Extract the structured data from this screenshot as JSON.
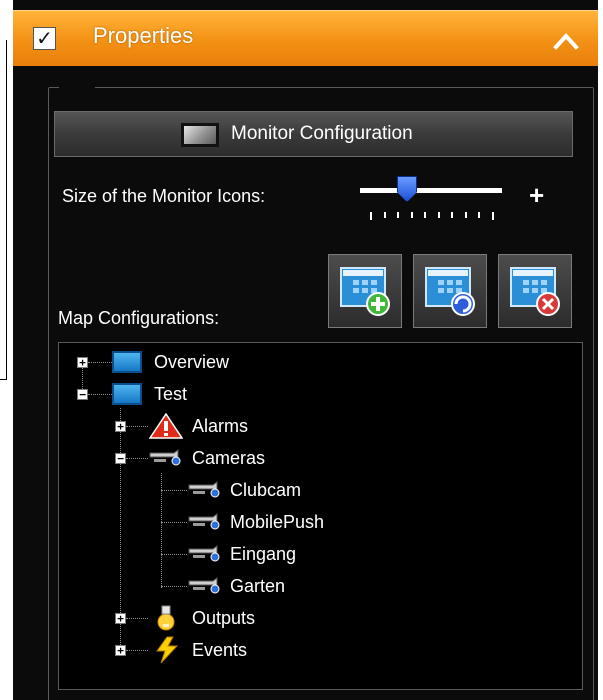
{
  "header": {
    "title": "Properties",
    "checked": true
  },
  "monitor_config": {
    "label": "Monitor Configuration"
  },
  "size_section": {
    "label": "Size of the Monitor Icons:",
    "plus": "+",
    "slider_level": 0.3
  },
  "map_section": {
    "label": "Map Configurations:",
    "buttons": [
      "add-map-icon",
      "refresh-map-icon",
      "delete-map-icon"
    ]
  },
  "tree": {
    "items": [
      {
        "label": "Overview",
        "expander": "+",
        "icon": "map-icon"
      },
      {
        "label": "Test",
        "expander": "−",
        "icon": "map-icon"
      },
      {
        "label": "Alarms",
        "expander": "+",
        "icon": "alarm-warning-icon"
      },
      {
        "label": "Cameras",
        "expander": "−",
        "icon": "camera-icon"
      },
      {
        "label": "Clubcam",
        "icon": "camera-icon"
      },
      {
        "label": "MobilePush",
        "icon": "camera-icon"
      },
      {
        "label": "Eingang",
        "icon": "camera-icon"
      },
      {
        "label": "Garten",
        "icon": "camera-icon"
      },
      {
        "label": "Outputs",
        "expander": "+",
        "icon": "light-bulb-icon"
      },
      {
        "label": "Events",
        "expander": "+",
        "icon": "lightning-event-icon"
      }
    ]
  },
  "colors": {
    "header_orange": "#f39114",
    "panel_background": "#0b0b0b",
    "slider_thumb": "#1a4fd8"
  }
}
